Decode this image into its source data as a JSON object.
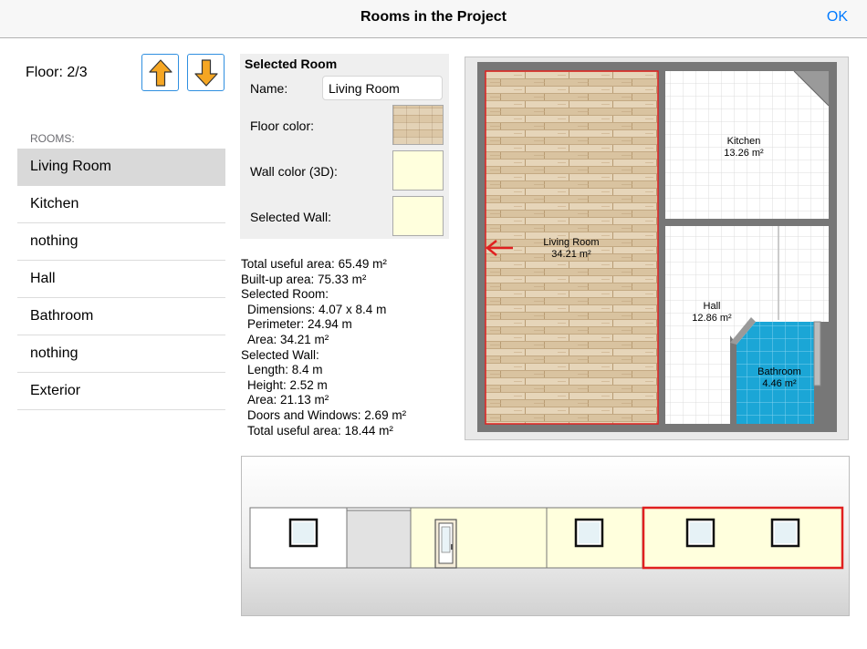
{
  "header": {
    "title": "Rooms in the Project",
    "ok_label": "OK"
  },
  "floor": {
    "label": "Floor: 2/3"
  },
  "rooms": {
    "header": "ROOMS:",
    "items": [
      {
        "label": "Living Room",
        "selected": true
      },
      {
        "label": "Kitchen",
        "selected": false
      },
      {
        "label": "nothing",
        "selected": false
      },
      {
        "label": "Hall",
        "selected": false
      },
      {
        "label": "Bathroom",
        "selected": false
      },
      {
        "label": "nothing",
        "selected": false
      },
      {
        "label": "Exterior",
        "selected": false
      }
    ]
  },
  "selected_room": {
    "title": "Selected Room",
    "name_label": "Name:",
    "name_value": "Living Room",
    "floor_color_label": "Floor color:",
    "wall_color_label": "Wall color (3D):",
    "selected_wall_label": "Selected Wall:",
    "wall_color": "#ffffdd",
    "selected_wall_color": "#ffffdd"
  },
  "stats": [
    {
      "text": "Total useful area: 65.49 m²",
      "indent": false
    },
    {
      "text": "Built-up area: 75.33 m²",
      "indent": false
    },
    {
      "text": "Selected Room:",
      "indent": false
    },
    {
      "text": "Dimensions: 4.07 x 8.4 m",
      "indent": true
    },
    {
      "text": "Perimeter: 24.94 m",
      "indent": true
    },
    {
      "text": "Area: 34.21 m²",
      "indent": true
    },
    {
      "text": "Selected Wall:",
      "indent": false
    },
    {
      "text": "Length: 8.4 m",
      "indent": true
    },
    {
      "text": "Height: 2.52 m",
      "indent": true
    },
    {
      "text": "Area: 21.13 m²",
      "indent": true
    },
    {
      "text": "Doors and Windows: 2.69 m²",
      "indent": true
    },
    {
      "text": "Total useful area: 18.44 m²",
      "indent": true
    }
  ],
  "plan": {
    "rooms": [
      {
        "name": "Living Room",
        "area": "34.21 m²"
      },
      {
        "name": "Kitchen",
        "area": "13.26 m²"
      },
      {
        "name": "Hall",
        "area": "12.86 m²"
      },
      {
        "name": "Bathroom",
        "area": "4.46 m²"
      }
    ],
    "selection_color": "#e02020",
    "bathroom_color": "#1ba6d6"
  },
  "colors": {
    "accent": "#007aff",
    "arrow": "#f5a623",
    "selection": "#e02020"
  }
}
